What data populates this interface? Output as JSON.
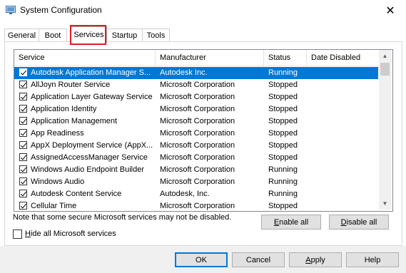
{
  "window": {
    "title": "System Configuration",
    "close_glyph": "✕"
  },
  "tabs": [
    {
      "label": "General"
    },
    {
      "label": "Boot"
    },
    {
      "label": "Services",
      "active": true
    },
    {
      "label": "Startup"
    },
    {
      "label": "Tools"
    }
  ],
  "table": {
    "columns": [
      "Service",
      "Manufacturer",
      "Status",
      "Date Disabled"
    ],
    "rows": [
      {
        "checked": true,
        "service": "Autodesk Application Manager S...",
        "manufacturer": "Autodesk Inc.",
        "status": "Running",
        "date": "",
        "selected": true
      },
      {
        "checked": true,
        "service": "AllJoyn Router Service",
        "manufacturer": "Microsoft Corporation",
        "status": "Stopped",
        "date": ""
      },
      {
        "checked": true,
        "service": "Application Layer Gateway Service",
        "manufacturer": "Microsoft Corporation",
        "status": "Stopped",
        "date": ""
      },
      {
        "checked": true,
        "service": "Application Identity",
        "manufacturer": "Microsoft Corporation",
        "status": "Stopped",
        "date": ""
      },
      {
        "checked": true,
        "service": "Application Management",
        "manufacturer": "Microsoft Corporation",
        "status": "Stopped",
        "date": ""
      },
      {
        "checked": true,
        "service": "App Readiness",
        "manufacturer": "Microsoft Corporation",
        "status": "Stopped",
        "date": ""
      },
      {
        "checked": true,
        "service": "AppX Deployment Service (AppX...",
        "manufacturer": "Microsoft Corporation",
        "status": "Stopped",
        "date": ""
      },
      {
        "checked": true,
        "service": "AssignedAccessManager Service",
        "manufacturer": "Microsoft Corporation",
        "status": "Stopped",
        "date": ""
      },
      {
        "checked": true,
        "service": "Windows Audio Endpoint Builder",
        "manufacturer": "Microsoft Corporation",
        "status": "Running",
        "date": ""
      },
      {
        "checked": true,
        "service": "Windows Audio",
        "manufacturer": "Microsoft Corporation",
        "status": "Running",
        "date": ""
      },
      {
        "checked": true,
        "service": "Autodesk Content Service",
        "manufacturer": "Autodesk, Inc.",
        "status": "Running",
        "date": ""
      },
      {
        "checked": true,
        "service": "Cellular Time",
        "manufacturer": "Microsoft Corporation",
        "status": "Stopped",
        "date": ""
      }
    ]
  },
  "note": "Note that some secure Microsoft services may not be disabled.",
  "buttons": {
    "enable_all_u": "E",
    "enable_all_rest": "nable all",
    "disable_all_u": "D",
    "disable_all_rest": "isable all",
    "ok": "OK",
    "cancel": "Cancel",
    "apply_u": "A",
    "apply_rest": "pply",
    "help": "Help"
  },
  "hide_ms": {
    "u": "H",
    "rest": "ide all Microsoft services",
    "checked": false
  },
  "colors": {
    "selection": "#0078d7",
    "highlight_box": "#e01b24"
  }
}
